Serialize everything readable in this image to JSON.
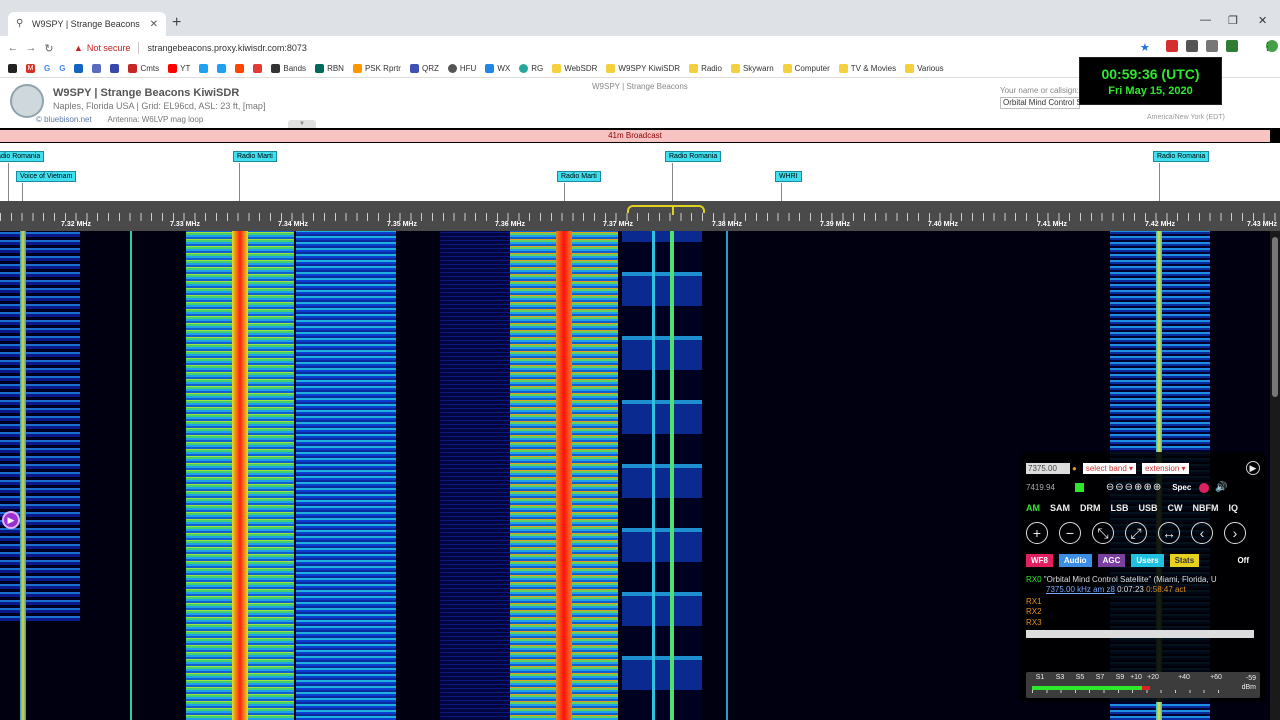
{
  "browser": {
    "tab_title": "W9SPY | Strange Beacons",
    "not_secure": "Not secure",
    "url": "strangebeacons.proxy.kiwisdr.com:8073"
  },
  "bookmarks": [
    "M",
    "G",
    "G",
    "Cmts",
    "YT",
    "Bands",
    "RBN",
    "PSK Rprtr",
    "QRZ",
    "HFU",
    "WX",
    "RG",
    "WebSDR",
    "W9SPY KiwiSDR",
    "Radio",
    "Skywarn",
    "Computer",
    "TV & Movies",
    "Various"
  ],
  "kiwi": {
    "title": "W9SPY | Strange Beacons KiwiSDR",
    "location": "Naples, Florida USA | Grid: EL96cd, ASL: 23 ft, [map]",
    "credit": "© bluebison.net",
    "antenna": "Antenna: W6LVP mag loop",
    "center_title": "W9SPY | Strange Beacons",
    "name_label": "Your name or callsign:",
    "name_value": "Orbital Mind Control Satellite",
    "timezone": "America/New York (EDT)"
  },
  "clock": {
    "utc": "00:59:36 (UTC)",
    "date": "Fri May 15, 2020"
  },
  "band": "41m Broadcast",
  "stations": [
    {
      "name": "Radio Romania"
    },
    {
      "name": "Voice of Vietnam"
    },
    {
      "name": "Radio Marti"
    },
    {
      "name": "Radio Marti"
    },
    {
      "name": "Radio Romania"
    },
    {
      "name": "WHRI"
    },
    {
      "name": "Radio Romania"
    }
  ],
  "freq_labels": [
    "7.32 MHz",
    "7.33 MHz",
    "7.34 MHz",
    "7.35 MHz",
    "7.36 MHz",
    "7.37 MHz",
    "7.38 MHz",
    "7.39 MHz",
    "7.40 MHz",
    "7.41 MHz",
    "7.42 MHz",
    "7.43 MHz"
  ],
  "panel": {
    "freq": "7375.00",
    "select_band": "select band",
    "extension": "extension",
    "readout": "7419.94",
    "spec": "Spec",
    "modes": [
      "AM",
      "SAM",
      "DRM",
      "LSB",
      "USB",
      "CW",
      "NBFM",
      "IQ"
    ],
    "tabs": [
      "WF8",
      "Audio",
      "AGC",
      "Users",
      "Stats",
      "Off"
    ],
    "rx0_label": "RX0",
    "rx0_user": "\"Orbital Mind Control Satellite\" (Miami, Florida, U",
    "rx0_freq": "7375.00 kHz am z8",
    "rx0_time": "0:07:23",
    "rx0_act": "0:58:47 act",
    "rx1": "RX1",
    "rx2": "RX2",
    "rx3": "RX3",
    "meter_labels": [
      "S1",
      "S3",
      "S5",
      "S7",
      "S9",
      "+10",
      "+20",
      "+40",
      "+60"
    ],
    "dbm_value": "-59",
    "dbm_unit": "dBm"
  }
}
